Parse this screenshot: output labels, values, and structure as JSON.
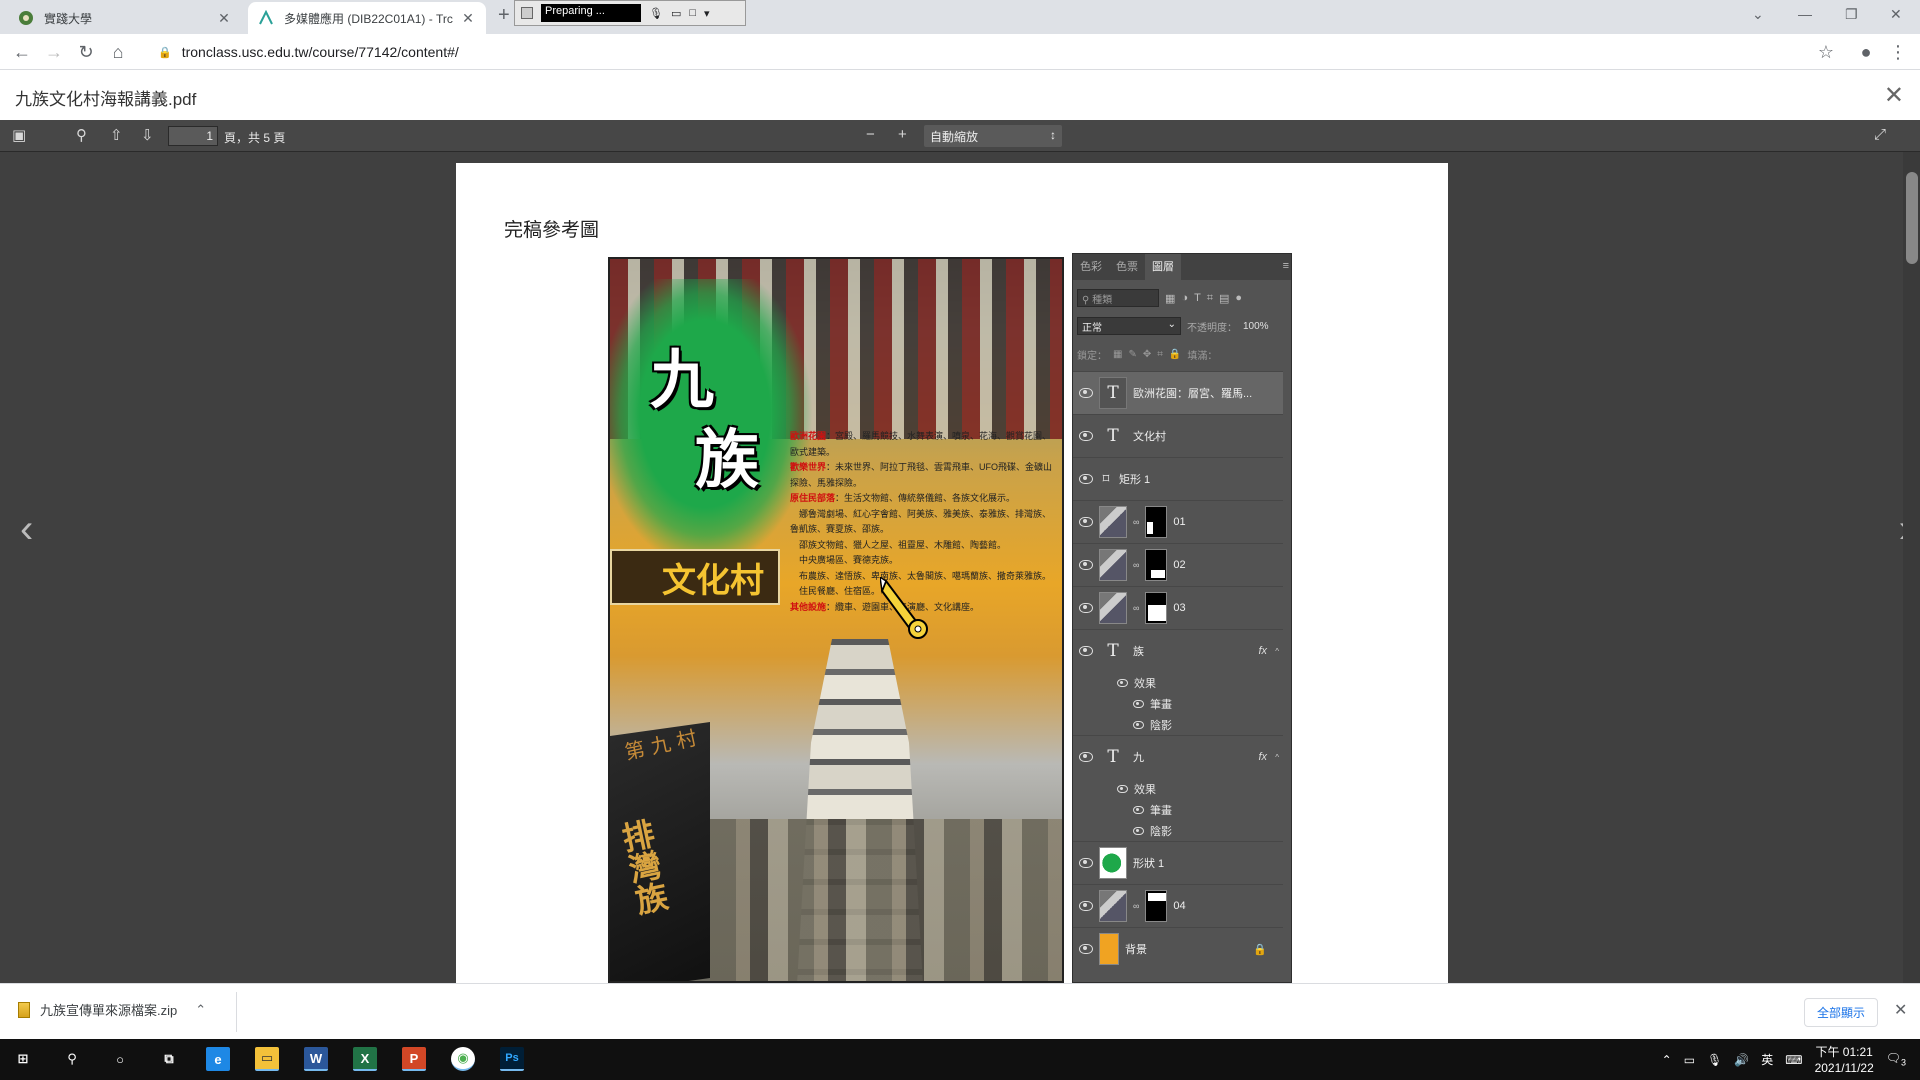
{
  "tabs": [
    {
      "label": "實踐大學",
      "icon": "university-icon"
    },
    {
      "label": "多媒體應用 (DIB22C01A1) - Trc",
      "icon": "tronclass-icon"
    }
  ],
  "recorder": {
    "status": "Preparing ..."
  },
  "address": {
    "url": "tronclass.usc.edu.tw/course/77142/content#/"
  },
  "doc": {
    "title": "九族文化村海報講義.pdf"
  },
  "pdf_toolbar": {
    "page_current": "1",
    "page_total": "頁，共 5 頁",
    "zoom": "自動縮放"
  },
  "page": {
    "heading": "完稿參考圖"
  },
  "poster": {
    "char1": "九",
    "char2": "族",
    "banner": "文化村",
    "stone_main": "排灣族",
    "stone_top": "第 九 村",
    "text_lines": [
      {
        "label": "歐洲花園",
        "body": "：宮殿、羅馬競技、水舞表演、噴泉、花海、觀賞花園、歐式建築。"
      },
      {
        "label": "歡樂世界",
        "body": "：未來世界、阿拉丁飛毯、雲霄飛車、UFO飛碟、金礦山探險、馬雅探險。"
      },
      {
        "label": "原住民部落",
        "body": "：生活文物館、傳統祭儀館、各族文化展示。"
      },
      {
        "label": "",
        "body": "　娜魯灣劇場、紅心字會館、阿美族、雅美族、泰雅族、排灣族、魯凱族、賽夏族、邵族。"
      },
      {
        "label": "",
        "body": "　邵族文物館、獵人之屋、祖靈屋、木雕館、陶藝館。"
      },
      {
        "label": "",
        "body": "　中央廣場區、賽德克族。"
      },
      {
        "label": "",
        "body": "　布農族、達悟族、卑南族、太魯閣族、噶瑪蘭族、撒奇萊雅族。"
      },
      {
        "label": "",
        "body": "　住民餐廳、住宿區。"
      },
      {
        "label": "其他設施",
        "body": "：纜車、遊園車、表演廳、文化講座。"
      }
    ]
  },
  "layers_panel": {
    "tabs": [
      "色彩",
      "色票",
      "圖層"
    ],
    "filter_placeholder": "種類",
    "blend_mode": "正常",
    "opacity_label": "不透明度：",
    "opacity_value": "100%",
    "lock_label": "鎖定：",
    "fill_label": "填滿：",
    "layers": [
      {
        "name": "歐洲花園：層宮、羅馬...",
        "kind": "text",
        "selected": true
      },
      {
        "name": "文化村",
        "kind": "text-plain"
      },
      {
        "name": "矩形 1",
        "kind": "shape-plain"
      },
      {
        "name": "01",
        "kind": "photo-mask",
        "mask": "m1"
      },
      {
        "name": "02",
        "kind": "photo-mask",
        "mask": "m2"
      },
      {
        "name": "03",
        "kind": "photo-mask",
        "mask": "m3"
      },
      {
        "name": "族",
        "kind": "text-fx",
        "effects": [
          "效果",
          "筆畫",
          "陰影"
        ]
      },
      {
        "name": "九",
        "kind": "text-fx",
        "effects": [
          "效果",
          "筆畫",
          "陰影"
        ]
      },
      {
        "name": "形狀 1",
        "kind": "green"
      },
      {
        "name": "04",
        "kind": "photo-mask",
        "mask": "m4"
      },
      {
        "name": "背景",
        "kind": "orange",
        "locked": true
      }
    ]
  },
  "download": {
    "filename": "九族宣傳單來源檔案.zip",
    "show_all": "全部顯示"
  },
  "taskbar": {
    "apps": [
      {
        "name": "start",
        "glyph": "⊞"
      },
      {
        "name": "search",
        "glyph": "⚲"
      },
      {
        "name": "cortana",
        "glyph": "○"
      },
      {
        "name": "task-view",
        "glyph": "⧉"
      },
      {
        "name": "edge",
        "glyph": "e",
        "color": "#1e88e5"
      },
      {
        "name": "file-explorer",
        "glyph": "▭",
        "color": "#f3c13a"
      },
      {
        "name": "word",
        "glyph": "W",
        "color": "#2b579a"
      },
      {
        "name": "excel",
        "glyph": "X",
        "color": "#217346"
      },
      {
        "name": "powerpoint",
        "glyph": "P",
        "color": "#d24726"
      },
      {
        "name": "chrome",
        "glyph": "◉",
        "color": "#4caf50"
      },
      {
        "name": "photoshop",
        "glyph": "Ps",
        "color": "#001e36"
      }
    ],
    "ime": "英",
    "time": "下午 01:21",
    "date": "2021/11/22",
    "notifications": "3"
  }
}
